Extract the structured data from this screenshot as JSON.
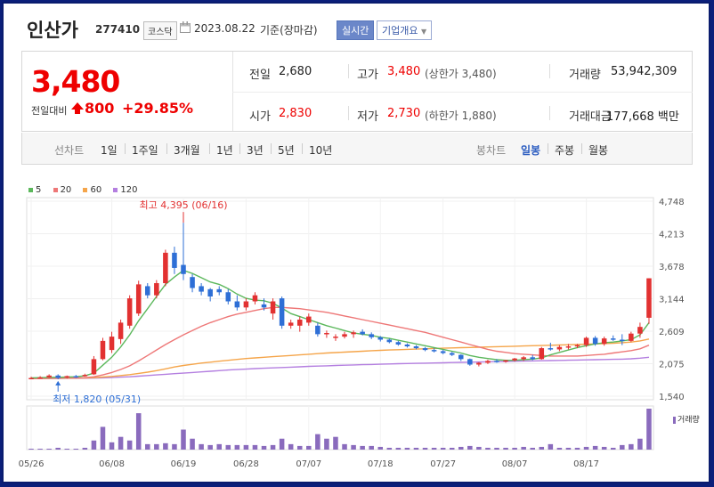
{
  "header": {
    "name": "인산가",
    "code": "277410",
    "market": "코스닥",
    "date": "2023.08.22",
    "basis": "기준(장마감)",
    "badge_realtime": "실시간",
    "badge_company": "기업개요"
  },
  "summary": {
    "price": "3,480",
    "change_label": "전일대비",
    "change_value": "800",
    "change_rate": "+29.85%",
    "prev_close_label": "전일",
    "prev_close": "2,680",
    "high_label": "고가",
    "high": "3,480",
    "upper_limit": "(상한가 3,480)",
    "volume_label": "거래량",
    "volume": "53,942,309",
    "open_label": "시가",
    "open": "2,830",
    "low_label": "저가",
    "low": "2,730",
    "lower_limit": "(하한가 1,880)",
    "amount_label": "거래대금",
    "amount": "177,668 백만"
  },
  "tabs": {
    "line_header": "선차트",
    "line": [
      "1일",
      "1주일",
      "3개월",
      "1년",
      "3년",
      "5년",
      "10년"
    ],
    "candle_header": "봉차트",
    "candle": [
      "일봉",
      "주봉",
      "월봉"
    ],
    "selected": "일봉"
  },
  "colors": {
    "up": "#e23131",
    "down": "#2e6fd6",
    "ma5": "#5cb85c",
    "ma20": "#ee7777",
    "ma60": "#f5a54a",
    "ma120": "#b47fe0",
    "volume": "#8a6bbd"
  },
  "legend": [
    {
      "label": "5",
      "color": "#5cb85c"
    },
    {
      "label": "20",
      "color": "#ee7777"
    },
    {
      "label": "60",
      "color": "#f5a54a"
    },
    {
      "label": "120",
      "color": "#b47fe0"
    }
  ],
  "volume_label": "거래량",
  "chart_data": {
    "type": "candlestick",
    "ylim": [
      1540,
      4748
    ],
    "y_ticks": [
      "4,748",
      "4,213",
      "3,678",
      "3,144",
      "2,609",
      "2,075",
      "1,540"
    ],
    "x_ticks": [
      "05/26",
      "06/08",
      "06/19",
      "06/28",
      "07/07",
      "07/18",
      "07/27",
      "08/07",
      "08/17"
    ],
    "annotation_high": "최고 4,395 (06/16)",
    "annotation_low": "최저 1,820 (05/31)",
    "candles": [
      {
        "o": 1830,
        "h": 1860,
        "l": 1820,
        "c": 1840,
        "v": 1
      },
      {
        "o": 1840,
        "h": 1870,
        "l": 1830,
        "c": 1850,
        "v": 1
      },
      {
        "o": 1850,
        "h": 1900,
        "l": 1840,
        "c": 1880,
        "v": 1
      },
      {
        "o": 1880,
        "h": 1900,
        "l": 1820,
        "c": 1840,
        "v": 2
      },
      {
        "o": 1850,
        "h": 1880,
        "l": 1830,
        "c": 1870,
        "v": 1
      },
      {
        "o": 1870,
        "h": 1890,
        "l": 1840,
        "c": 1860,
        "v": 1
      },
      {
        "o": 1880,
        "h": 1910,
        "l": 1860,
        "c": 1890,
        "v": 2
      },
      {
        "o": 1900,
        "h": 2200,
        "l": 1890,
        "c": 2150,
        "v": 10
      },
      {
        "o": 2150,
        "h": 2500,
        "l": 2130,
        "c": 2450,
        "v": 25
      },
      {
        "o": 2300,
        "h": 2600,
        "l": 2250,
        "c": 2520,
        "v": 8
      },
      {
        "o": 2480,
        "h": 2800,
        "l": 2400,
        "c": 2750,
        "v": 14
      },
      {
        "o": 2700,
        "h": 3200,
        "l": 2650,
        "c": 3150,
        "v": 10
      },
      {
        "o": 2900,
        "h": 3440,
        "l": 2860,
        "c": 3380,
        "v": 40
      },
      {
        "o": 3350,
        "h": 3400,
        "l": 3150,
        "c": 3200,
        "v": 6
      },
      {
        "o": 3200,
        "h": 3450,
        "l": 3150,
        "c": 3400,
        "v": 6
      },
      {
        "o": 3400,
        "h": 3950,
        "l": 3350,
        "c": 3900,
        "v": 7
      },
      {
        "o": 3900,
        "h": 4000,
        "l": 3550,
        "c": 3650,
        "v": 6
      },
      {
        "o": 3700,
        "h": 4395,
        "l": 3450,
        "c": 3550,
        "v": 22
      },
      {
        "o": 3500,
        "h": 3550,
        "l": 3250,
        "c": 3320,
        "v": 12
      },
      {
        "o": 3350,
        "h": 3400,
        "l": 3200,
        "c": 3260,
        "v": 6
      },
      {
        "o": 3300,
        "h": 3320,
        "l": 3100,
        "c": 3180,
        "v": 5
      },
      {
        "o": 3300,
        "h": 3350,
        "l": 3200,
        "c": 3250,
        "v": 6
      },
      {
        "o": 3250,
        "h": 3300,
        "l": 3050,
        "c": 3100,
        "v": 5
      },
      {
        "o": 3100,
        "h": 3200,
        "l": 2950,
        "c": 3000,
        "v": 5
      },
      {
        "o": 3000,
        "h": 3150,
        "l": 2950,
        "c": 3100,
        "v": 5
      },
      {
        "o": 3100,
        "h": 3250,
        "l": 3050,
        "c": 3200,
        "v": 5
      },
      {
        "o": 3050,
        "h": 3150,
        "l": 2950,
        "c": 3000,
        "v": 4
      },
      {
        "o": 2900,
        "h": 3150,
        "l": 2800,
        "c": 3100,
        "v": 5
      },
      {
        "o": 3150,
        "h": 3180,
        "l": 2650,
        "c": 2700,
        "v": 12
      },
      {
        "o": 2700,
        "h": 2800,
        "l": 2650,
        "c": 2750,
        "v": 6
      },
      {
        "o": 2700,
        "h": 2850,
        "l": 2600,
        "c": 2800,
        "v": 4
      },
      {
        "o": 2750,
        "h": 2900,
        "l": 2700,
        "c": 2850,
        "v": 4
      },
      {
        "o": 2700,
        "h": 2750,
        "l": 2520,
        "c": 2560,
        "v": 17
      },
      {
        "o": 2560,
        "h": 2620,
        "l": 2500,
        "c": 2580,
        "v": 12
      },
      {
        "o": 2500,
        "h": 2560,
        "l": 2450,
        "c": 2520,
        "v": 14
      },
      {
        "o": 2520,
        "h": 2600,
        "l": 2490,
        "c": 2560,
        "v": 6
      },
      {
        "o": 2560,
        "h": 2620,
        "l": 2500,
        "c": 2590,
        "v": 5
      },
      {
        "o": 2600,
        "h": 2640,
        "l": 2540,
        "c": 2560,
        "v": 4
      },
      {
        "o": 2560,
        "h": 2590,
        "l": 2480,
        "c": 2510,
        "v": 4
      },
      {
        "o": 2510,
        "h": 2530,
        "l": 2440,
        "c": 2470,
        "v": 3
      },
      {
        "o": 2470,
        "h": 2490,
        "l": 2410,
        "c": 2430,
        "v": 2
      },
      {
        "o": 2430,
        "h": 2450,
        "l": 2370,
        "c": 2390,
        "v": 2
      },
      {
        "o": 2390,
        "h": 2410,
        "l": 2340,
        "c": 2360,
        "v": 2
      },
      {
        "o": 2360,
        "h": 2380,
        "l": 2310,
        "c": 2330,
        "v": 2
      },
      {
        "o": 2330,
        "h": 2350,
        "l": 2280,
        "c": 2300,
        "v": 2
      },
      {
        "o": 2300,
        "h": 2330,
        "l": 2260,
        "c": 2280,
        "v": 2
      },
      {
        "o": 2280,
        "h": 2300,
        "l": 2230,
        "c": 2250,
        "v": 2
      },
      {
        "o": 2250,
        "h": 2270,
        "l": 2200,
        "c": 2220,
        "v": 2
      },
      {
        "o": 2220,
        "h": 2230,
        "l": 2120,
        "c": 2150,
        "v": 3
      },
      {
        "o": 2150,
        "h": 2160,
        "l": 2040,
        "c": 2060,
        "v": 4
      },
      {
        "o": 2060,
        "h": 2100,
        "l": 2030,
        "c": 2090,
        "v": 3
      },
      {
        "o": 2090,
        "h": 2140,
        "l": 2070,
        "c": 2120,
        "v": 2
      },
      {
        "o": 2120,
        "h": 2150,
        "l": 2090,
        "c": 2110,
        "v": 2
      },
      {
        "o": 2110,
        "h": 2140,
        "l": 2090,
        "c": 2130,
        "v": 2
      },
      {
        "o": 2130,
        "h": 2170,
        "l": 2110,
        "c": 2160,
        "v": 2
      },
      {
        "o": 2150,
        "h": 2200,
        "l": 2120,
        "c": 2180,
        "v": 3
      },
      {
        "o": 2180,
        "h": 2220,
        "l": 2130,
        "c": 2150,
        "v": 2
      },
      {
        "o": 2150,
        "h": 2350,
        "l": 2140,
        "c": 2330,
        "v": 3
      },
      {
        "o": 2330,
        "h": 2420,
        "l": 2290,
        "c": 2310,
        "v": 6
      },
      {
        "o": 2310,
        "h": 2380,
        "l": 2280,
        "c": 2350,
        "v": 2
      },
      {
        "o": 2350,
        "h": 2400,
        "l": 2310,
        "c": 2360,
        "v": 2
      },
      {
        "o": 2360,
        "h": 2400,
        "l": 2330,
        "c": 2380,
        "v": 2
      },
      {
        "o": 2380,
        "h": 2520,
        "l": 2350,
        "c": 2500,
        "v": 3
      },
      {
        "o": 2500,
        "h": 2530,
        "l": 2370,
        "c": 2400,
        "v": 4
      },
      {
        "o": 2400,
        "h": 2520,
        "l": 2370,
        "c": 2490,
        "v": 3
      },
      {
        "o": 2490,
        "h": 2540,
        "l": 2450,
        "c": 2470,
        "v": 2
      },
      {
        "o": 2470,
        "h": 2560,
        "l": 2380,
        "c": 2450,
        "v": 5
      },
      {
        "o": 2450,
        "h": 2600,
        "l": 2430,
        "c": 2570,
        "v": 6
      },
      {
        "o": 2570,
        "h": 2750,
        "l": 2500,
        "c": 2680,
        "v": 12
      },
      {
        "o": 2830,
        "h": 3480,
        "l": 2730,
        "c": 3480,
        "v": 45
      }
    ],
    "ma5": [
      1840,
      1845,
      1850,
      1850,
      1855,
      1860,
      1875,
      1920,
      2050,
      2180,
      2350,
      2550,
      2780,
      2980,
      3180,
      3380,
      3500,
      3610,
      3560,
      3490,
      3420,
      3380,
      3310,
      3220,
      3150,
      3120,
      3110,
      3070,
      2990,
      2900,
      2850,
      2800,
      2750,
      2700,
      2660,
      2620,
      2580,
      2560,
      2540,
      2510,
      2490,
      2460,
      2430,
      2400,
      2370,
      2340,
      2310,
      2280,
      2250,
      2210,
      2180,
      2160,
      2140,
      2130,
      2130,
      2140,
      2150,
      2170,
      2220,
      2260,
      2300,
      2340,
      2370,
      2400,
      2420,
      2430,
      2450,
      2470,
      2550,
      2750
    ],
    "ma20": [
      1830,
      1832,
      1835,
      1838,
      1840,
      1842,
      1845,
      1860,
      1890,
      1930,
      1980,
      2040,
      2120,
      2210,
      2300,
      2390,
      2470,
      2550,
      2620,
      2690,
      2750,
      2800,
      2850,
      2890,
      2920,
      2950,
      2980,
      3000,
      3000,
      2990,
      2980,
      2960,
      2940,
      2920,
      2890,
      2860,
      2830,
      2800,
      2770,
      2740,
      2710,
      2680,
      2650,
      2620,
      2590,
      2550,
      2510,
      2470,
      2430,
      2390,
      2350,
      2310,
      2280,
      2260,
      2240,
      2230,
      2220,
      2210,
      2200,
      2200,
      2200,
      2200,
      2210,
      2220,
      2230,
      2250,
      2270,
      2290,
      2320,
      2380
    ],
    "ma60": [
      1830,
      1831,
      1832,
      1834,
      1836,
      1838,
      1840,
      1845,
      1855,
      1865,
      1880,
      1895,
      1915,
      1935,
      1960,
      1990,
      2020,
      2045,
      2065,
      2085,
      2100,
      2115,
      2130,
      2145,
      2160,
      2170,
      2180,
      2190,
      2200,
      2210,
      2220,
      2230,
      2240,
      2250,
      2258,
      2265,
      2272,
      2280,
      2288,
      2295,
      2300,
      2305,
      2310,
      2315,
      2320,
      2325,
      2330,
      2334,
      2338,
      2342,
      2346,
      2350,
      2354,
      2358,
      2362,
      2366,
      2370,
      2374,
      2378,
      2382,
      2386,
      2390,
      2395,
      2400,
      2405,
      2410,
      2420,
      2430,
      2450,
      2480
    ],
    "ma120": [
      1830,
      1831,
      1832,
      1833,
      1834,
      1835,
      1836,
      1838,
      1842,
      1847,
      1853,
      1860,
      1870,
      1880,
      1890,
      1900,
      1910,
      1920,
      1930,
      1940,
      1950,
      1960,
      1970,
      1978,
      1986,
      1994,
      2000,
      2006,
      2012,
      2018,
      2024,
      2030,
      2035,
      2040,
      2045,
      2050,
      2054,
      2058,
      2062,
      2066,
      2070,
      2074,
      2078,
      2081,
      2084,
      2087,
      2090,
      2093,
      2096,
      2099,
      2102,
      2105,
      2108,
      2111,
      2114,
      2117,
      2120,
      2123,
      2126,
      2129,
      2132,
      2135,
      2138,
      2141,
      2144,
      2147,
      2150,
      2155,
      2165,
      2180
    ]
  }
}
